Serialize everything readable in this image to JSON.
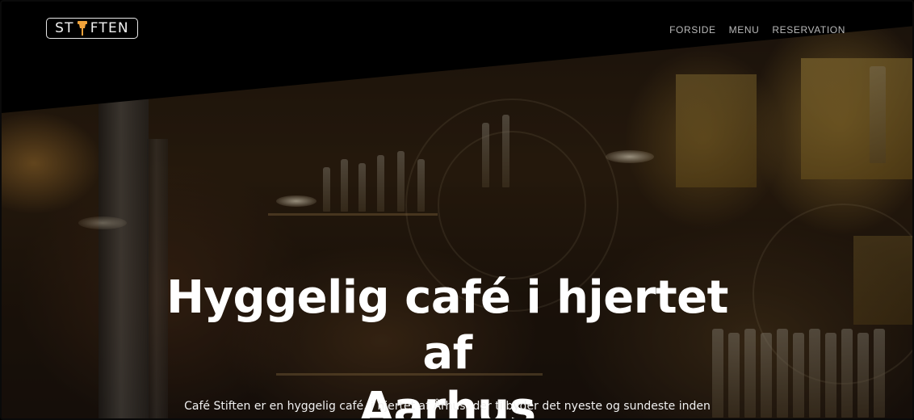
{
  "header": {
    "logo_text_left": "ST",
    "logo_text_right": "FTEN",
    "nav": [
      {
        "label": "FORSIDE"
      },
      {
        "label": "MENU"
      },
      {
        "label": "RESERVATION"
      }
    ]
  },
  "hero": {
    "title_line1": "Hyggelig café i hjertet af",
    "title_line2": "Aarhus",
    "subtitle": "Café Stiften er en hyggelig café, i hjertet af Århus, der tilbyder det nyeste og sundeste inden"
  },
  "colors": {
    "accent_pin": "#f0a23a",
    "nav_text": "#b9b9b9",
    "band": "#000000"
  },
  "icons": {
    "logo_pin": "pushpin-icon"
  }
}
